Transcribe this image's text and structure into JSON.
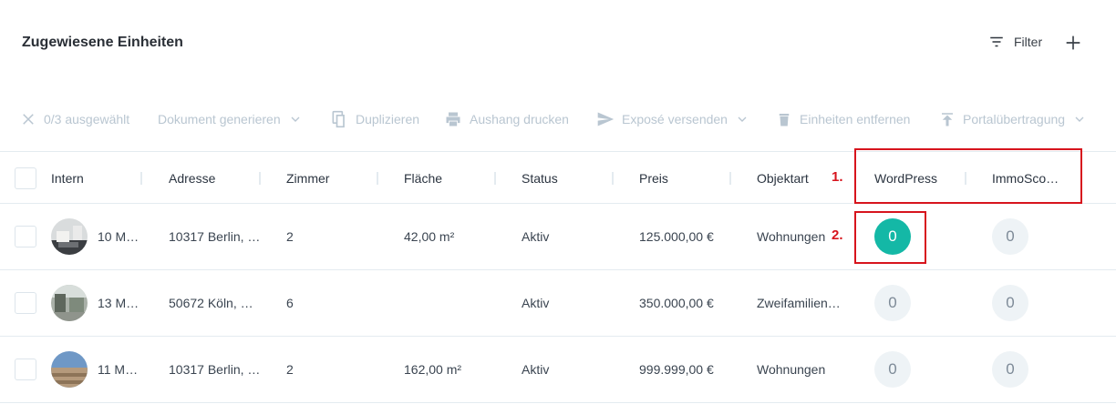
{
  "header": {
    "title": "Zugewiesene Einheiten",
    "filter_label": "Filter"
  },
  "toolbar": {
    "selected": "0/3 ausgewählt",
    "generate_doc": "Dokument generieren",
    "duplicate": "Duplizieren",
    "print_notice": "Aushang drucken",
    "send_expose": "Exposé versenden",
    "remove_units": "Einheiten entfernen",
    "portal_transfer": "Portalübertragung"
  },
  "table": {
    "columns": [
      "Intern",
      "Adresse",
      "Zimmer",
      "Fläche",
      "Status",
      "Preis",
      "Objektart",
      "WordPress",
      "ImmoSco…"
    ],
    "rows": [
      {
        "intern": "10 M…",
        "address": "10317 Berlin, …",
        "rooms": "2",
        "area": "42,00 m²",
        "status": "Aktiv",
        "price": "125.000,00 €",
        "type": "Wohnungen",
        "wordpress": "0",
        "immosco": "0"
      },
      {
        "intern": "13 M…",
        "address": "50672 Köln, …",
        "rooms": "6",
        "area": "",
        "status": "Aktiv",
        "price": "350.000,00 €",
        "type": "Zweifamilien…",
        "wordpress": "0",
        "immosco": "0"
      },
      {
        "intern": "11 M…",
        "address": "10317 Berlin, …",
        "rooms": "2",
        "area": "162,00 m²",
        "status": "Aktiv",
        "price": "999.999,00 €",
        "type": "Wohnungen",
        "wordpress": "0",
        "immosco": "0"
      }
    ]
  },
  "annotations": {
    "marker_1": "1.",
    "marker_2": "2."
  },
  "colors": {
    "accent": "#14b8a6",
    "annotation": "#d7141d",
    "disabled": "#b9c6d1"
  }
}
